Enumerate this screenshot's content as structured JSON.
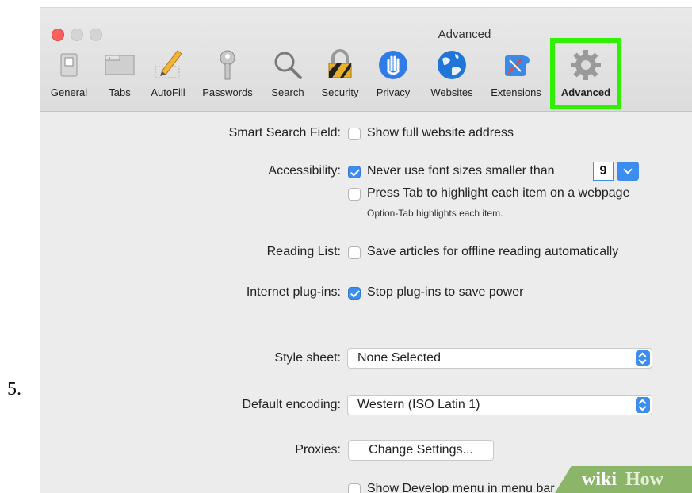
{
  "step_number": "5.",
  "window": {
    "title": "Advanced"
  },
  "toolbar": {
    "items": [
      {
        "label": "General",
        "icon": "general-switch-icon"
      },
      {
        "label": "Tabs",
        "icon": "tabs-icon"
      },
      {
        "label": "AutoFill",
        "icon": "autofill-pencil-icon"
      },
      {
        "label": "Passwords",
        "icon": "key-icon"
      },
      {
        "label": "Search",
        "icon": "magnifier-icon"
      },
      {
        "label": "Security",
        "icon": "padlock-icon"
      },
      {
        "label": "Privacy",
        "icon": "hand-icon"
      },
      {
        "label": "Websites",
        "icon": "globe-icon"
      },
      {
        "label": "Extensions",
        "icon": "puzzle-icon"
      },
      {
        "label": "Advanced",
        "icon": "gear-icon"
      }
    ],
    "selected": "Advanced",
    "highlight_color": "#2ff000"
  },
  "settings": {
    "smart_search": {
      "label": "Smart Search Field:",
      "option": "Show full website address",
      "checked": false
    },
    "accessibility": {
      "label": "Accessibility:",
      "option1": "Never use font sizes smaller than",
      "option1_checked": true,
      "font_size": "9",
      "option2": "Press Tab to highlight each item on a webpage",
      "option2_checked": false,
      "hint": "Option-Tab highlights each item."
    },
    "reading_list": {
      "label": "Reading List:",
      "option": "Save articles for offline reading automatically",
      "checked": false
    },
    "plugins": {
      "label": "Internet plug-ins:",
      "option": "Stop plug-ins to save power",
      "checked": true
    },
    "style_sheet": {
      "label": "Style sheet:",
      "value": "None Selected"
    },
    "encoding": {
      "label": "Default encoding:",
      "value": "Western (ISO Latin 1)"
    },
    "proxies": {
      "label": "Proxies:",
      "button": "Change Settings..."
    },
    "develop": {
      "option": "Show Develop menu in menu bar",
      "checked": false
    }
  },
  "colors": {
    "accent": "#3b8ef0"
  },
  "watermark": {
    "wiki": "wiki",
    "how": "How"
  }
}
